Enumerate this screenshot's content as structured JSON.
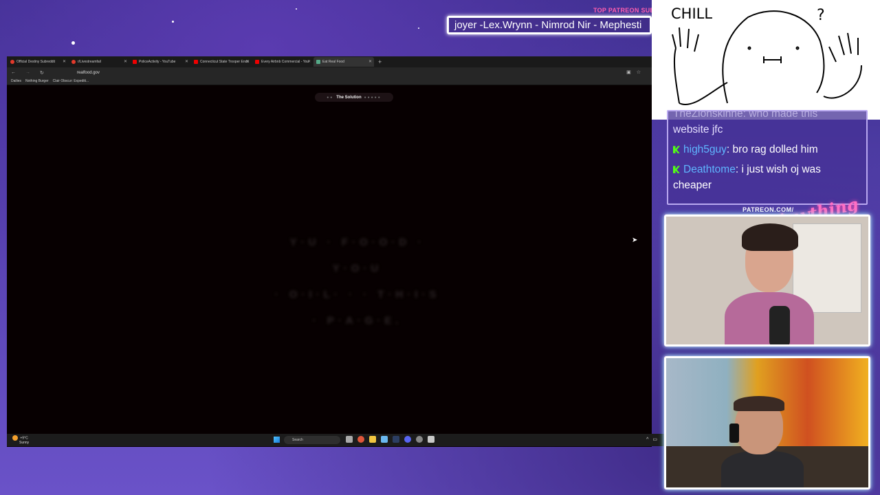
{
  "overlay": {
    "patreon_label": "TOP PATREON SUBS",
    "ticker_text": "joyer -Lex.Wrynn - Nimrod Nir - Mephesti",
    "sketch_text": "CHILL",
    "sketch_mark": "?",
    "patreon_url": "PATREON.COM/",
    "brand_script": "Anything Else?"
  },
  "browser": {
    "tabs": [
      {
        "label": "Official Destiny Subreddit",
        "icon": "reddit-icon"
      },
      {
        "label": "r/Livestreamfail",
        "icon": "reddit-icon"
      },
      {
        "label": "PoliceActivity - YouTube",
        "icon": "youtube-icon"
      },
      {
        "label": "Connecticut State Trooper Ends",
        "icon": "youtube-icon"
      },
      {
        "label": "Every Airbnb Commercial - You",
        "icon": "youtube-icon"
      },
      {
        "label": "Eat Real Food",
        "icon": "page-icon",
        "active": true
      }
    ],
    "address": "realfood.gov",
    "bookmarks": [
      "Dailies",
      "Nothing Burger",
      "Clair Obscur: Expediti..."
    ],
    "page": {
      "section_pill": "The Solution",
      "hero_line1": "Y·U · F·O·O·D · Y·O·U",
      "hero_line2": "· O·I·L· · · T·H·I·S · P·A·G·E."
    }
  },
  "taskbar": {
    "weather_temp": "+9°C",
    "weather_desc": "Sunny",
    "search_placeholder": "Search"
  },
  "chat": {
    "messages": [
      {
        "user": "",
        "text": "website jfc",
        "partial_top": "TheZionskinne: who made this"
      },
      {
        "user": "high5guy",
        "text": "bro rag dolled him"
      },
      {
        "user": "Deathtome",
        "text": "i just wish oj was cheaper"
      }
    ]
  },
  "colors": {
    "accent_pink": "#ff5fb0",
    "chat_user": "#5fb6ff",
    "kick_green": "#53fc18"
  }
}
